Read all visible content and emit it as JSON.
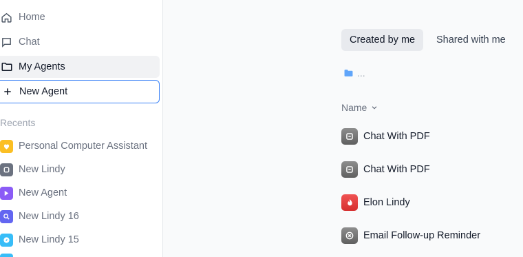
{
  "sidebar": {
    "nav": [
      {
        "label": "Home",
        "icon": "home-icon"
      },
      {
        "label": "Chat",
        "icon": "chat-bubble-icon"
      },
      {
        "label": "My Agents",
        "icon": "folder-icon"
      },
      {
        "label": "New Agent",
        "icon": "plus-icon"
      }
    ],
    "recents_label": "Recents",
    "recents": [
      {
        "label": "Personal Computer Assistant",
        "color": "#fbbf24",
        "icon": "heart-icon"
      },
      {
        "label": "New Lindy",
        "color": "#6b7280",
        "icon": "app-icon"
      },
      {
        "label": "New Agent",
        "color": "#8b5cf6",
        "icon": "app-icon"
      },
      {
        "label": "New Lindy 16",
        "color": "#6366f1",
        "icon": "search-icon"
      },
      {
        "label": "New Lindy 15",
        "color": "#38bdf8",
        "icon": "compass-icon"
      }
    ]
  },
  "main": {
    "tabs": [
      {
        "label": "Created by me",
        "active": true
      },
      {
        "label": "Shared with me",
        "active": false
      }
    ],
    "breadcrumb": "...",
    "column_header": "Name",
    "agents": [
      {
        "label": "Chat With PDF",
        "color": "#6b7280",
        "icon": "pdf-chat-icon"
      },
      {
        "label": "Chat With PDF",
        "color": "#6b7280",
        "icon": "pdf-chat-icon"
      },
      {
        "label": "Elon Lindy",
        "color": "#ef4444",
        "icon": "flame-icon"
      },
      {
        "label": "Email Follow-up Reminder",
        "color": "#6b7280",
        "icon": "close-circle-icon"
      }
    ]
  },
  "colors": {
    "accent": "#3b82f6",
    "active_bg": "#f1f2f4",
    "folder_blue": "#60a5fa"
  }
}
